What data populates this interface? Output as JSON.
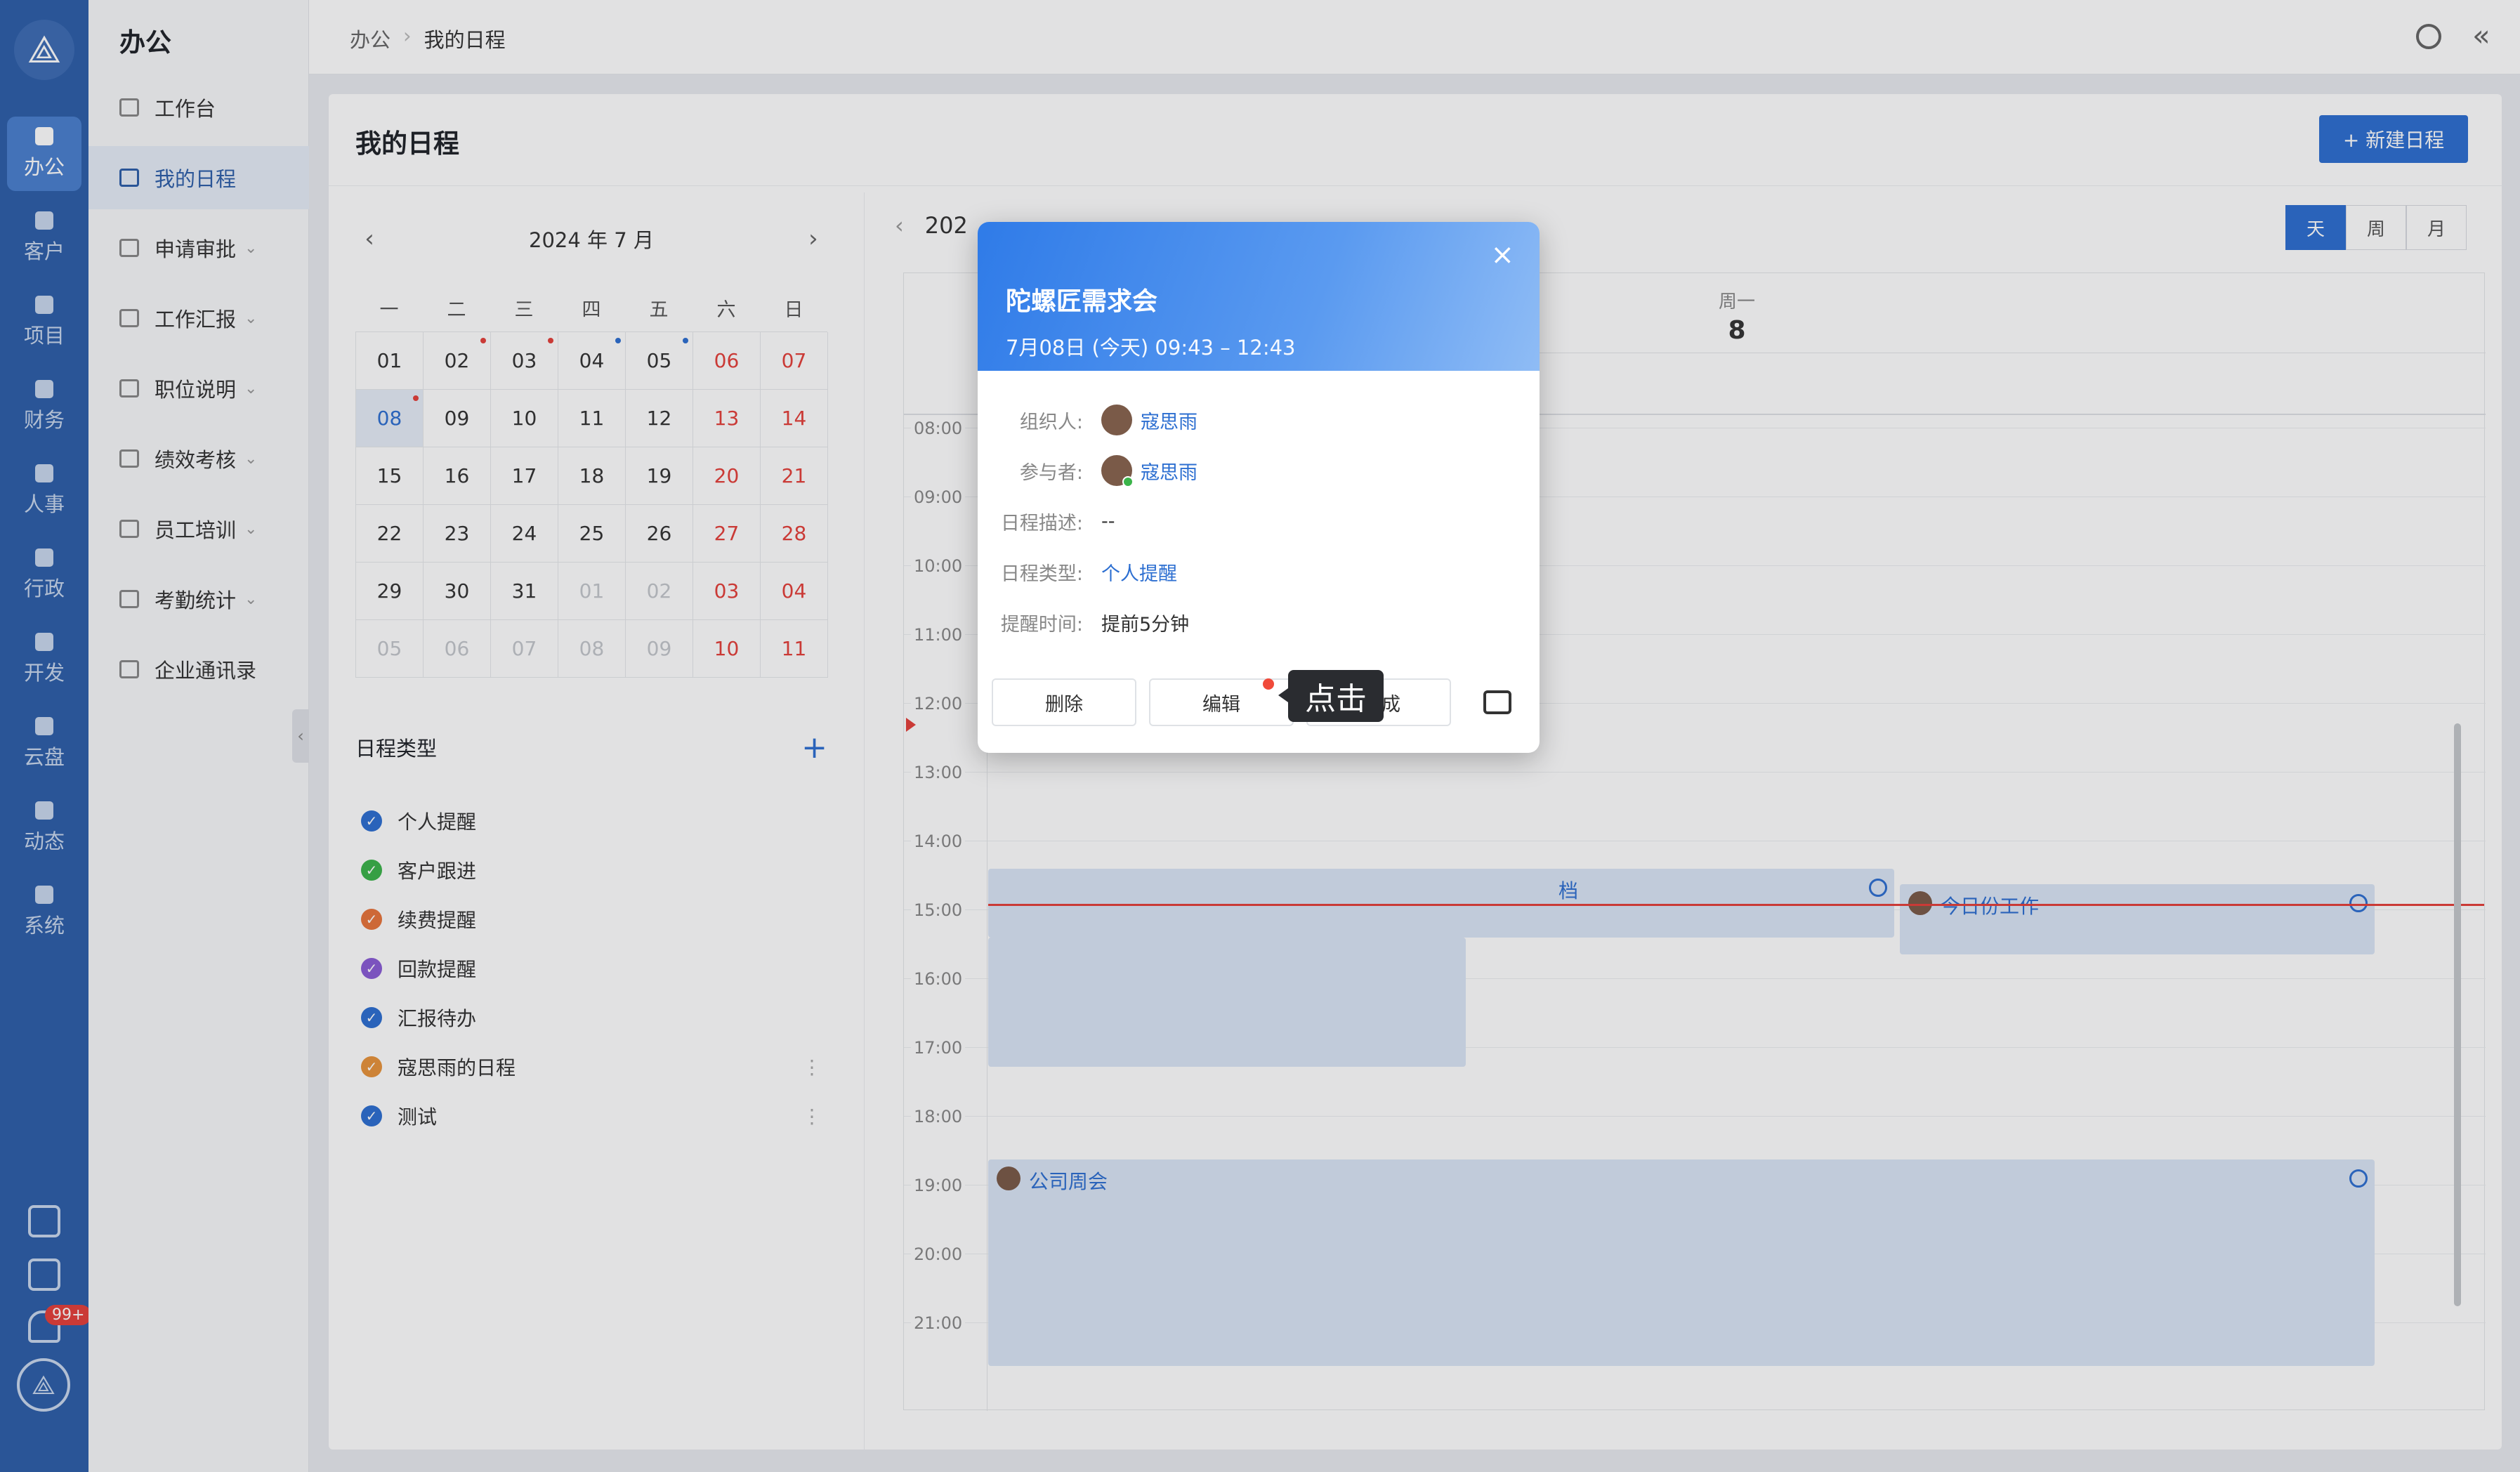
{
  "rail": {
    "items": [
      "办公",
      "客户",
      "项目",
      "财务",
      "人事",
      "行政",
      "开发",
      "云盘",
      "动态",
      "系统"
    ],
    "badge": "99+"
  },
  "nav": {
    "title": "办公",
    "items": [
      "工作台",
      "我的日程",
      "申请审批",
      "工作汇报",
      "职位说明",
      "绩效考核",
      "员工培训",
      "考勤统计",
      "企业通讯录"
    ]
  },
  "breadcrumb": [
    "办公",
    "我的日程"
  ],
  "page": {
    "title": "我的日程",
    "new_button": "+ 新建日程"
  },
  "mini_calendar": {
    "month_label": "2024 年 7 月",
    "weekdays": [
      "一",
      "二",
      "三",
      "四",
      "五",
      "六",
      "日"
    ],
    "weeks": [
      [
        "01",
        "02",
        "03",
        "04",
        "05",
        "06",
        "07"
      ],
      [
        "08",
        "09",
        "10",
        "11",
        "12",
        "13",
        "14"
      ],
      [
        "15",
        "16",
        "17",
        "18",
        "19",
        "20",
        "21"
      ],
      [
        "22",
        "23",
        "24",
        "25",
        "26",
        "27",
        "28"
      ],
      [
        "29",
        "30",
        "31",
        "01",
        "02",
        "03",
        "04"
      ],
      [
        "05",
        "06",
        "07",
        "08",
        "09",
        "10",
        "11"
      ]
    ],
    "today": "08"
  },
  "schedule_types": {
    "title": "日程类型",
    "items": [
      {
        "label": "个人提醒",
        "color": "#2d6fd1"
      },
      {
        "label": "客户跟进",
        "color": "#3bb44a"
      },
      {
        "label": "续费提醒",
        "color": "#e8743b"
      },
      {
        "label": "回款提醒",
        "color": "#8a5cd6"
      },
      {
        "label": "汇报待办",
        "color": "#2d6fd1"
      },
      {
        "label": "寇思雨的日程",
        "color": "#e8943b"
      },
      {
        "label": "测试",
        "color": "#2d6fd1"
      }
    ]
  },
  "day_view": {
    "header_partial": "202",
    "tabs": [
      "天",
      "周",
      "月"
    ],
    "active_tab": "天",
    "weekday": "周一",
    "day_number": "8",
    "hours": [
      "08:00",
      "09:00",
      "10:00",
      "11:00",
      "12:00",
      "13:00",
      "14:00",
      "15:00",
      "16:00",
      "17:00",
      "18:00",
      "19:00",
      "20:00",
      "21:00"
    ],
    "events": [
      {
        "title": "档"
      },
      {
        "title": "今日份工作"
      },
      {
        "title": "公司周会"
      }
    ]
  },
  "modal": {
    "title": "陀螺匠需求会",
    "subtitle": "7月08日 (今天) 09:43 – 12:43",
    "close": "×",
    "organizer_label": "组织人:",
    "organizer": "寇思雨",
    "participant_label": "参与者:",
    "participant": "寇思雨",
    "desc_label": "日程描述:",
    "desc": "--",
    "type_label": "日程类型:",
    "type": "个人提醒",
    "reminder_label": "提醒时间:",
    "reminder": "提前5分钟",
    "buttons": {
      "delete": "删除",
      "edit": "编辑",
      "complete": "完成"
    }
  },
  "tooltip": "点击"
}
